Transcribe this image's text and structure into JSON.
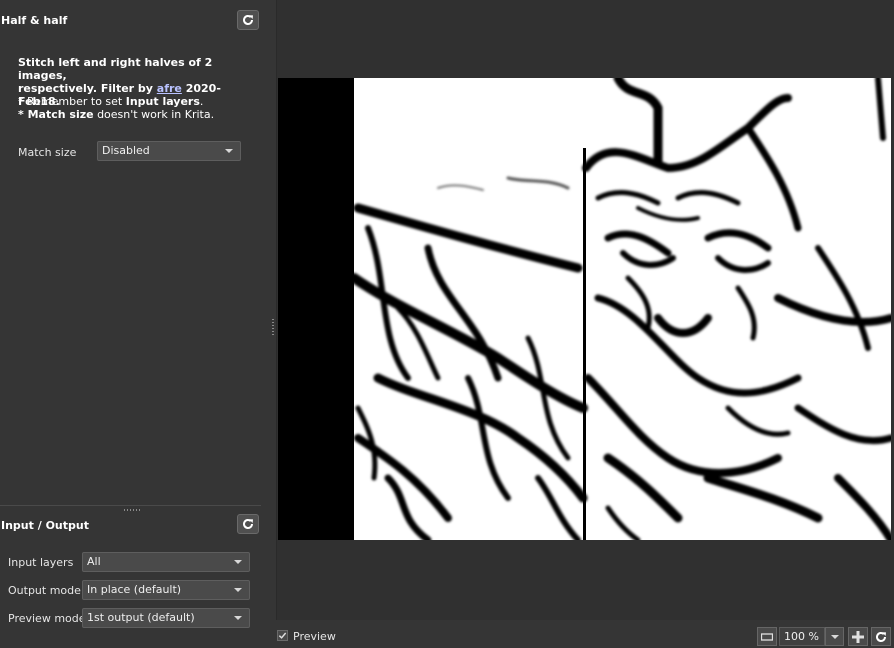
{
  "filter": {
    "title": "Half & half",
    "description_line1": "Stitch left and right halves of 2 images,",
    "description_line2_prefix": "respectively.  Filter by ",
    "author_link": "afre",
    "description_line2_suffix": " 2020-Feb18.",
    "note1_prefix": "* Remember to set ",
    "note1_bold": "Input layers",
    "note1_suffix": ".",
    "note2_bold": "* Match size",
    "note2_suffix": " doesn't work in Krita.",
    "match_size_label": "Match size",
    "match_size_value": "Disabled"
  },
  "io": {
    "title": "Input / Output",
    "input_layers_label": "Input layers",
    "input_layers_value": "All",
    "output_mode_label": "Output mode",
    "output_mode_value": "In place (default)",
    "preview_mode_label": "Preview mode",
    "preview_mode_value": "1st output (default)"
  },
  "preview": {
    "checkbox_label": "Preview",
    "checked": true,
    "zoom_value": "100 %"
  },
  "icons": {
    "reset": "refresh-icon",
    "zoom_out": "zoom-fit-icon",
    "zoom_in": "zoom-in-icon",
    "refresh_preview": "refresh-icon"
  },
  "colors": {
    "panel_bg": "#353535",
    "preview_bg": "#303030",
    "link": "#b9c2ff"
  }
}
